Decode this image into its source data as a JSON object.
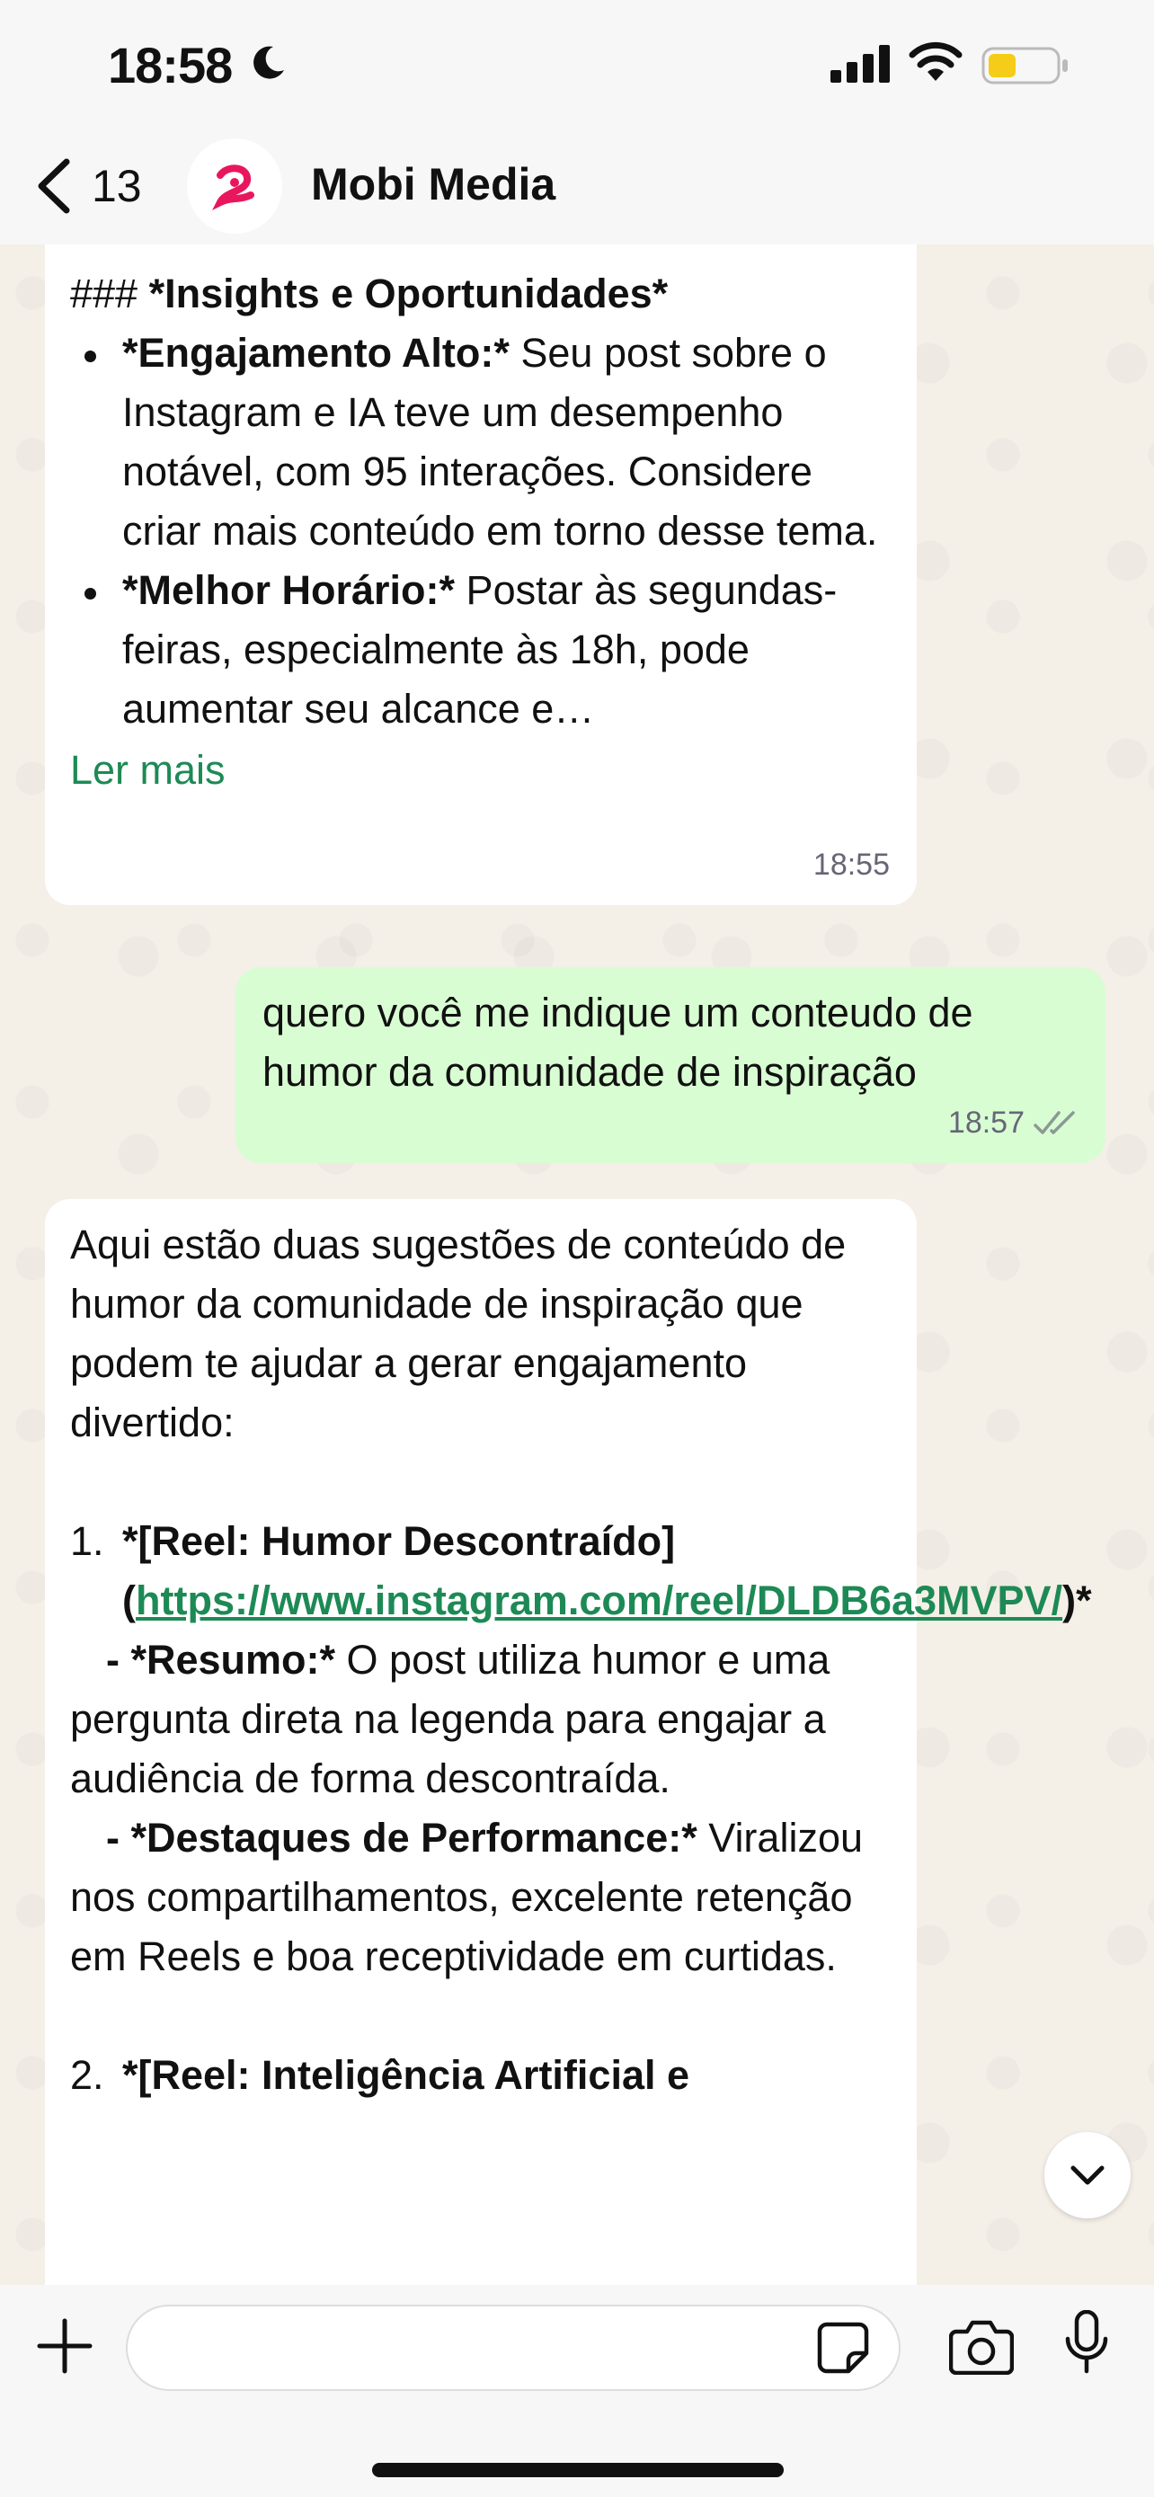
{
  "status_bar": {
    "time": "18:58"
  },
  "header": {
    "back_count": "13",
    "contact_name": "Mobi Media"
  },
  "messages": {
    "m1": {
      "heading_prefix": "### ",
      "heading": "*Insights e Oportunidades*",
      "bullet1_bold": "*Engajamento Alto:*",
      "bullet1_text": " Seu post sobre o Instagram e IA teve um desempenho notável, com 95 interações. Considere criar mais conteúdo em torno desse tema.",
      "bullet2_bold": "*Melhor Horário:*",
      "bullet2_text": " Postar às segundas-feiras, especialmente às 18h, pode aumentar seu alcance e…",
      "read_more": "Ler mais",
      "time": "18:55"
    },
    "m2": {
      "text": "quero você me indique um conteudo de humor da comunidade de inspiração",
      "time": "18:57"
    },
    "m3": {
      "intro": "Aqui estão duas sugestões de conteúdo de humor da comunidade de inspiração que podem te ajudar a gerar engajamento divertido:",
      "item1_num": "1.",
      "item1_title": "*[Reel: Humor Descontraído]",
      "item1_paren_open": "(",
      "item1_link": "https://www.instagram.com/reel/DLDB6a3MVPV/",
      "item1_paren_close": ")*",
      "summary_label": "- *Resumo:*",
      "summary_text": " O post utiliza humor e uma pergunta direta na legenda para engajar a audiência de forma descontraída.",
      "perf_label": "- *Destaques de Performance:*",
      "perf_text": " Viralizou nos compartilhamentos, excelente retenção em Reels e boa receptividade em curtidas.",
      "item2_num": "2.",
      "item2_title": "*[Reel: Inteligência Artificial e"
    }
  },
  "input": {
    "placeholder": ""
  }
}
